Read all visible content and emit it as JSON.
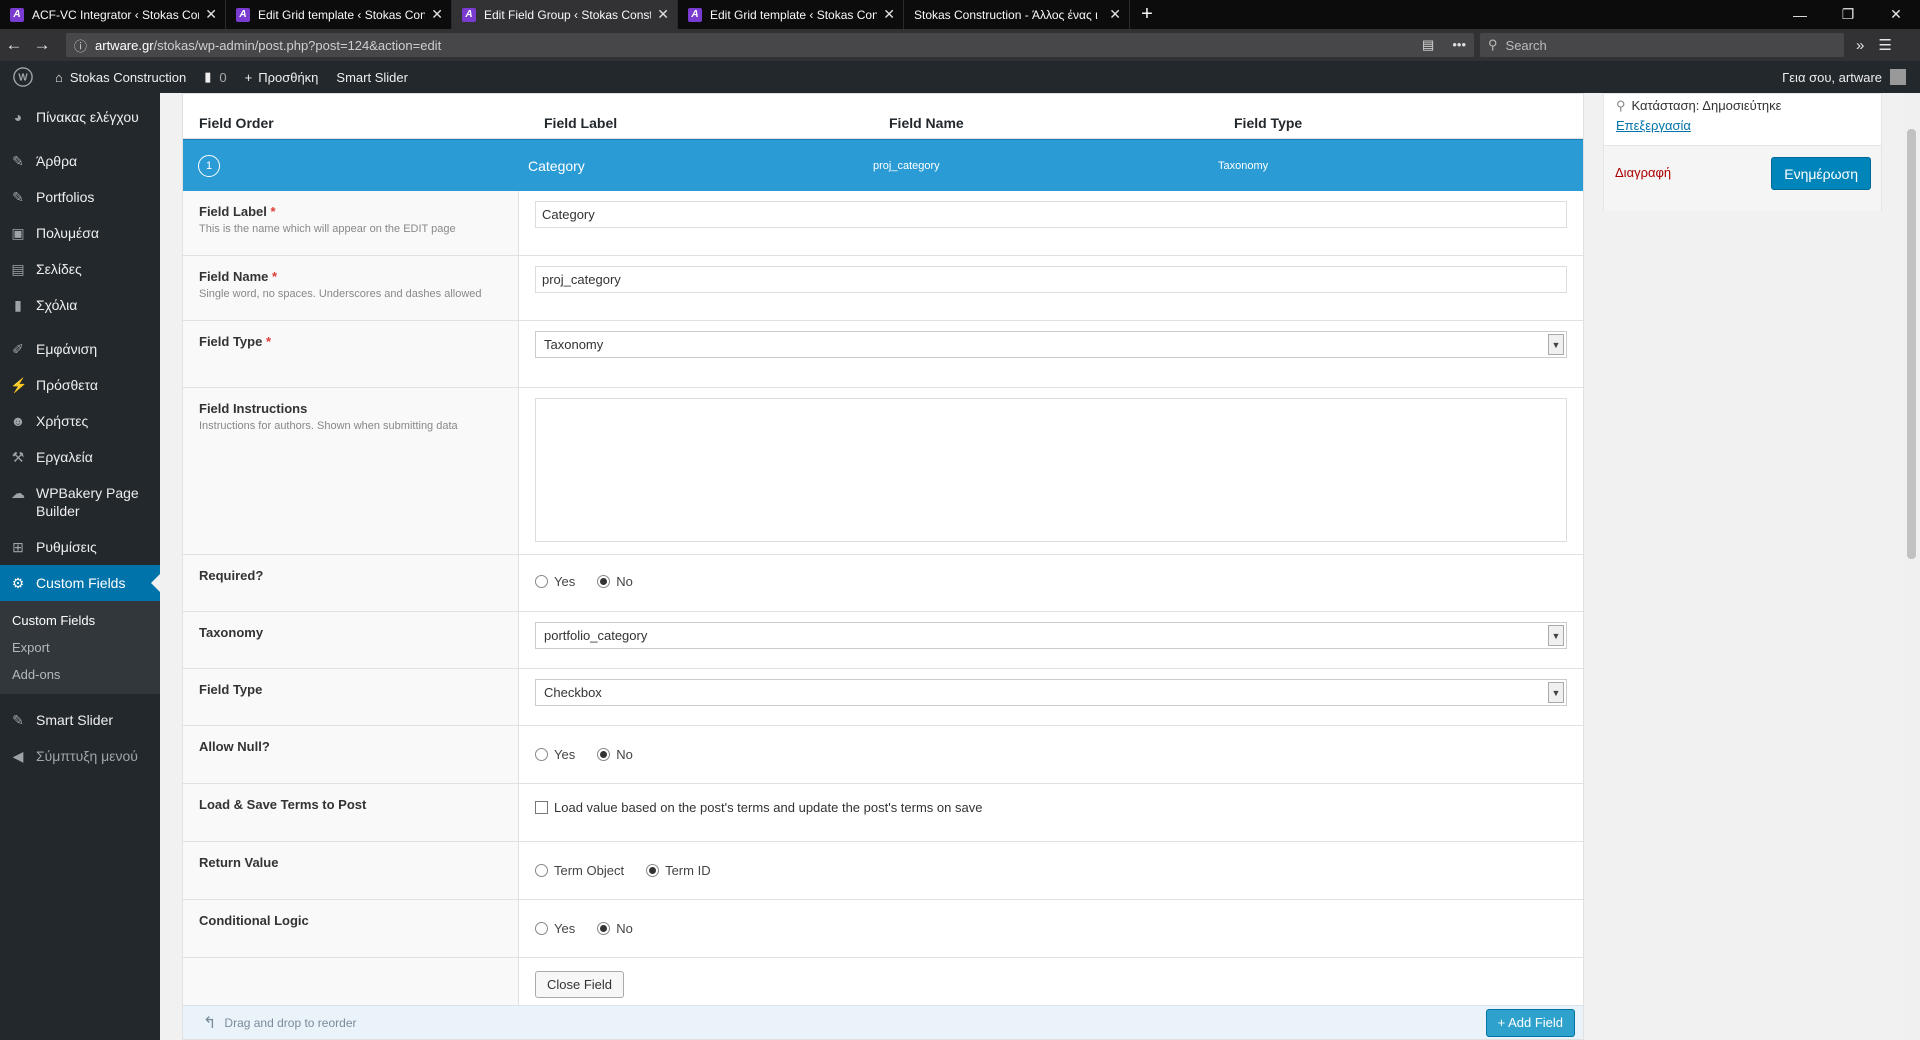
{
  "browser": {
    "tabs": [
      {
        "title": "ACF-VC Integrator ‹ Stokas Cor",
        "active": false
      },
      {
        "title": "Edit Grid template ‹ Stokas Con",
        "active": false
      },
      {
        "title": "Edit Field Group ‹ Stokas Const",
        "active": true
      },
      {
        "title": "Edit Grid template ‹ Stokas Con",
        "active": false
      },
      {
        "title": "Stokas Construction - Άλλος ένας ι",
        "active": false
      }
    ],
    "url_domain": "artware.gr",
    "url_path": "/stokas/wp-admin/post.php?post=124&action=edit",
    "search_placeholder": "Search"
  },
  "adminbar": {
    "site_name": "Stokas Construction",
    "comments_count": "0",
    "new_label": "Προσθήκη",
    "smart_slider": "Smart Slider",
    "greeting": "Γεια σου, artware"
  },
  "sidebar": {
    "items": [
      {
        "label": "Πίνακας ελέγχου",
        "icon": "dashboard-icon"
      },
      {
        "label": "Άρθρα",
        "icon": "pin-icon"
      },
      {
        "label": "Portfolios",
        "icon": "pin-icon"
      },
      {
        "label": "Πολυμέσα",
        "icon": "media-icon"
      },
      {
        "label": "Σελίδες",
        "icon": "page-icon"
      },
      {
        "label": "Σχόλια",
        "icon": "comment-icon"
      },
      {
        "label": "Εμφάνιση",
        "icon": "brush-icon"
      },
      {
        "label": "Πρόσθετα",
        "icon": "plugin-icon"
      },
      {
        "label": "Χρήστες",
        "icon": "user-icon"
      },
      {
        "label": "Εργαλεία",
        "icon": "wrench-icon"
      },
      {
        "label": "WPBakery Page Builder",
        "icon": "cloud-icon"
      },
      {
        "label": "Ρυθμίσεις",
        "icon": "settings-icon"
      },
      {
        "label": "Custom Fields",
        "icon": "gear-icon"
      }
    ],
    "submenu": [
      "Custom Fields",
      "Export",
      "Add-ons"
    ],
    "after": [
      {
        "label": "Smart Slider",
        "icon": "slider-icon"
      },
      {
        "label": "Σύμπτυξη μενού",
        "icon": "collapse-icon"
      }
    ]
  },
  "table": {
    "headers": [
      "Field Order",
      "Field Label",
      "Field Name",
      "Field Type"
    ],
    "active_field": {
      "order": "1",
      "label": "Category",
      "name": "proj_category",
      "type": "Taxonomy"
    }
  },
  "form": {
    "field_label": {
      "label": "Field Label",
      "desc": "This is the name which will appear on the EDIT page",
      "value": "Category"
    },
    "field_name": {
      "label": "Field Name",
      "desc": "Single word, no spaces. Underscores and dashes allowed",
      "value": "proj_category"
    },
    "field_type": {
      "label": "Field Type",
      "value": "Taxonomy"
    },
    "instructions": {
      "label": "Field Instructions",
      "desc": "Instructions for authors. Shown when submitting data",
      "value": ""
    },
    "required": {
      "label": "Required?",
      "yes": "Yes",
      "no": "No",
      "selected": "No"
    },
    "taxonomy": {
      "label": "Taxonomy",
      "value": "portfolio_category"
    },
    "tax_field_type": {
      "label": "Field Type",
      "value": "Checkbox"
    },
    "allow_null": {
      "label": "Allow Null?",
      "yes": "Yes",
      "no": "No",
      "selected": "No"
    },
    "load_save": {
      "label": "Load & Save Terms to Post",
      "checkbox_label": "Load value based on the post's terms and update the post's terms on save",
      "checked": false
    },
    "return_value": {
      "label": "Return Value",
      "opt1": "Term Object",
      "opt2": "Term ID",
      "selected": "Term ID"
    },
    "conditional": {
      "label": "Conditional Logic",
      "yes": "Yes",
      "no": "No",
      "selected": "No"
    },
    "close_button": "Close Field",
    "required_mark": "*"
  },
  "footer": {
    "drag_text": "Drag and drop to reorder",
    "add_button": "+ Add Field"
  },
  "publish": {
    "status": "Κατάσταση: Δημοσιεύτηκε",
    "edit": "Επεξεργασία",
    "delete": "Διαγραφή",
    "update": "Ενημέρωση"
  }
}
